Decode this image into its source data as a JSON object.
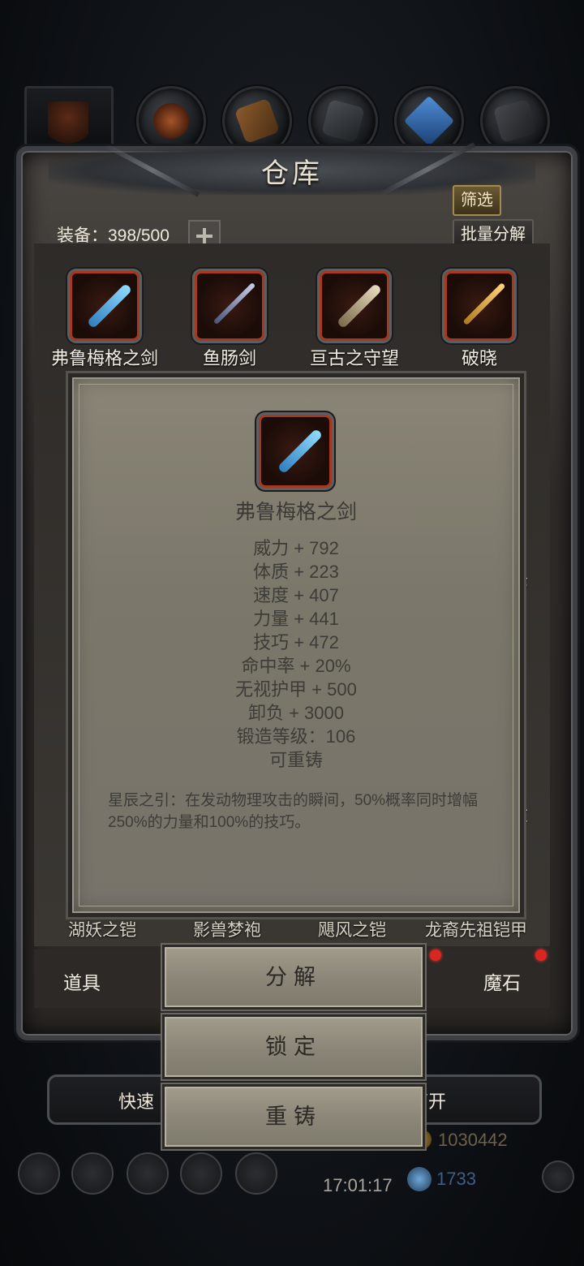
{
  "window": {
    "title": "仓库"
  },
  "header": {
    "capacity_label": "装备：398/500",
    "filter_button": "筛选",
    "batch_button": "批量分解"
  },
  "items": [
    {
      "name": "弗鲁梅格之剑",
      "color": "#5fb8e8"
    },
    {
      "name": "鱼肠剑",
      "color": "#9aa6c8"
    },
    {
      "name": "亘古之守望",
      "color": "#c9b27a"
    },
    {
      "name": "破晓",
      "color": "#e2a93a"
    }
  ],
  "row2_partial": [
    "湖妖之铠",
    "影兽梦袍",
    "飓风之铠",
    "龙裔先祖铠甲"
  ],
  "side_partial": {
    "right_a": "枪",
    "right_b": "杖"
  },
  "tabs": {
    "left": "道具",
    "right": "魔石"
  },
  "bottom": {
    "left_text": "快速",
    "right_text": "离开"
  },
  "resources": {
    "gold": "1030442",
    "gems": "1733",
    "clock": "17:01:17"
  },
  "tooltip": {
    "name": "弗鲁梅格之剑",
    "stats": [
      "威力 + 792",
      "体质 + 223",
      "速度 + 407",
      "力量 + 441",
      "技巧 + 472",
      "命中率 + 20%",
      "无视护甲 + 500",
      "卸负 + 3000",
      "锻造等级：106",
      "可重铸"
    ],
    "description": "星辰之引：在发动物理攻击的瞬间，50%概率同时增幅250%的力量和100%的技巧。"
  },
  "actions": {
    "decompose": "分解",
    "lock": "锁定",
    "recast": "重铸"
  }
}
